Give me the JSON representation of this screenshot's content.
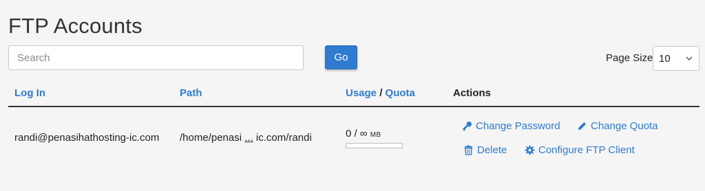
{
  "page": {
    "title": "FTP Accounts"
  },
  "search": {
    "placeholder": "Search",
    "value": "",
    "go_label": "Go"
  },
  "page_size": {
    "label": "Page Size",
    "selected": "10"
  },
  "table": {
    "headers": {
      "login": "Log In",
      "path": "Path",
      "usage": "Usage",
      "usage_sep": "/",
      "quota": "Quota",
      "actions": "Actions"
    },
    "rows": [
      {
        "login": "randi@penasihathosting-ic.com",
        "path_start": "/home/penasi",
        "path_ellipsis": "...",
        "path_end": "ic.com/randi",
        "usage_text": "0 / ∞",
        "usage_unit": "MB",
        "usage_fraction": 0,
        "actions": {
          "change_password": "Change Password",
          "change_quota": "Change Quota",
          "delete": "Delete",
          "configure": "Configure FTP Client"
        }
      }
    ]
  },
  "icons": {
    "change_password": "key-icon",
    "change_quota": "pencil-icon",
    "delete": "trash-icon",
    "configure": "gear-icon",
    "page_size_chevron": "chevron-down-icon"
  },
  "colors": {
    "accent": "#2f7bd0",
    "background": "#f5f5f5",
    "text": "#222222"
  }
}
